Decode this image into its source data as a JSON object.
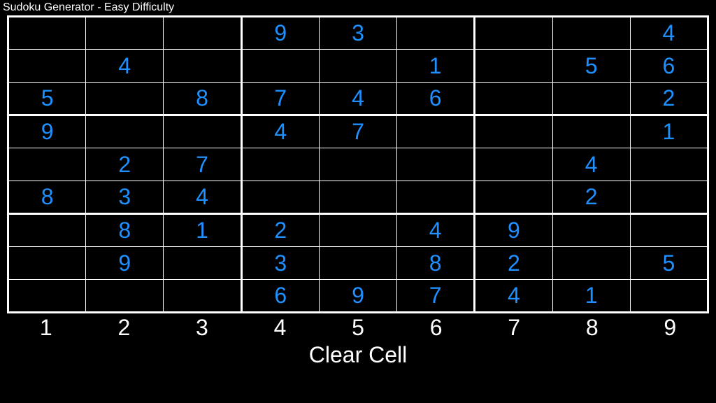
{
  "title": "Sudoku Generator - Easy Difficulty",
  "grid": [
    [
      "",
      "",
      "",
      "9",
      "3",
      "",
      "",
      "",
      "4"
    ],
    [
      "",
      "4",
      "",
      "",
      "",
      "1",
      "",
      "5",
      "6"
    ],
    [
      "5",
      "",
      "8",
      "7",
      "4",
      "6",
      "",
      "",
      "2"
    ],
    [
      "9",
      "",
      "",
      "4",
      "7",
      "",
      "",
      "",
      "1"
    ],
    [
      "",
      "2",
      "7",
      "",
      "",
      "",
      "",
      "4",
      ""
    ],
    [
      "8",
      "3",
      "4",
      "",
      "",
      "",
      "",
      "2",
      ""
    ],
    [
      "",
      "8",
      "1",
      "2",
      "",
      "4",
      "9",
      "",
      ""
    ],
    [
      "",
      "9",
      "",
      "3",
      "",
      "8",
      "2",
      "",
      "5"
    ],
    [
      "",
      "",
      "",
      "6",
      "9",
      "7",
      "4",
      "1",
      ""
    ]
  ],
  "numbers": [
    "1",
    "2",
    "3",
    "4",
    "5",
    "6",
    "7",
    "8",
    "9"
  ],
  "clear_label": "Clear Cell"
}
